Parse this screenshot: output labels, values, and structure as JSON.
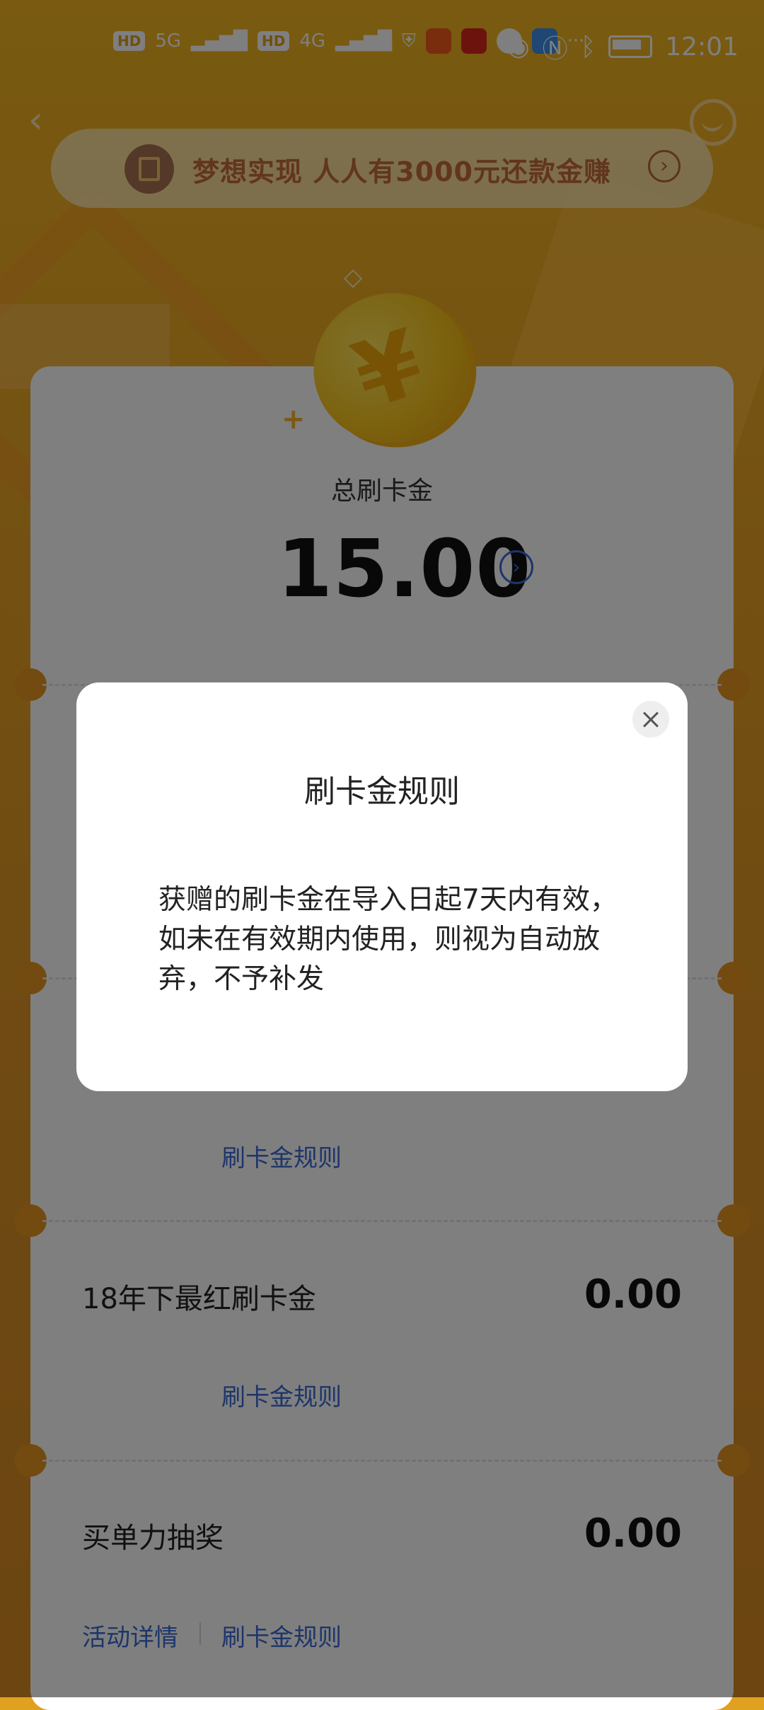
{
  "status_bar": {
    "sim1": "HD",
    "sim2": "HD",
    "net1": "5G",
    "net2": "4G",
    "more": "···",
    "time": "12:01"
  },
  "promo": {
    "text": "梦想实现  人人有3000元还款金赚"
  },
  "summary": {
    "label": "总刷卡金",
    "amount": "15.00"
  },
  "items": [
    {
      "title": "18年下最红刷卡金",
      "value": "0.00",
      "links": [
        "刷卡金规则"
      ]
    },
    {
      "title": "买单力抽奖",
      "value": "0.00",
      "links": [
        "活动详情",
        "刷卡金规则"
      ]
    }
  ],
  "partial_link": "刷卡金规则",
  "dialog": {
    "title": "刷卡金规则",
    "body": "获赠的刷卡金在导入日起7天内有效，如未在有效期内使用，则视为自动放弃，不予补发"
  },
  "colors": {
    "accent": "#3a6ad6",
    "background": "#e9a523",
    "overlay": "rgba(0,0,0,0.5)"
  }
}
